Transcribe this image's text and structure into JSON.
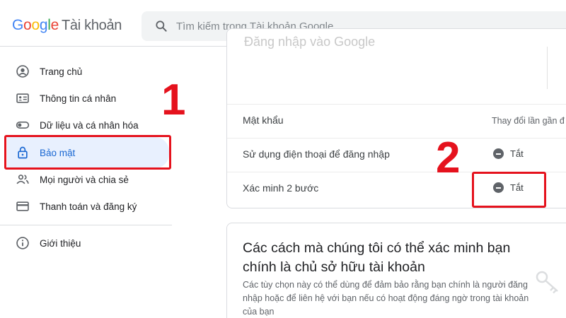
{
  "header": {
    "logo_letters": [
      "G",
      "o",
      "o",
      "g",
      "l",
      "e"
    ],
    "product": "Tài khoản",
    "search_placeholder": "Tìm kiếm trong Tài khoản Google",
    "icon": "search-icon"
  },
  "sidebar": {
    "items": [
      {
        "label": "Trang chủ",
        "icon": "account-circle-icon"
      },
      {
        "label": "Thông tin cá nhân",
        "icon": "id-card-icon"
      },
      {
        "label": "Dữ liệu và cá nhân hóa",
        "icon": "toggle-icon"
      },
      {
        "label": "Bảo mật",
        "icon": "lock-icon",
        "active": true
      },
      {
        "label": "Mọi người và chia sẻ",
        "icon": "people-icon"
      },
      {
        "label": "Thanh toán và đăng ký",
        "icon": "credit-card-icon"
      }
    ],
    "footer_item": {
      "label": "Giới thiệu",
      "icon": "info-icon"
    },
    "active_color": "#1967d2"
  },
  "signin_card": {
    "faded_title": "Đăng nhập vào Google",
    "rows": [
      {
        "label": "Mật khẩu",
        "value": "Thay đổi lần gần đ"
      },
      {
        "label": "Sử dụng điện thoại để đăng nhập",
        "status": "Tắt"
      },
      {
        "label": "Xác minh 2 bước",
        "status": "Tắt"
      }
    ]
  },
  "verify_card": {
    "heading": "Các cách mà chúng tôi có thể xác minh bạn chính là chủ sở hữu tài khoản",
    "description": "Các tùy chọn này có thể dùng để đảm bảo rằng bạn chính là người đăng nhập hoặc để liên hệ với bạn nếu có hoạt động đáng ngờ trong tài khoản của bạn",
    "icon": "key-icon"
  },
  "annotations": {
    "step1": "1",
    "step2": "2",
    "color": "#e5121d"
  }
}
